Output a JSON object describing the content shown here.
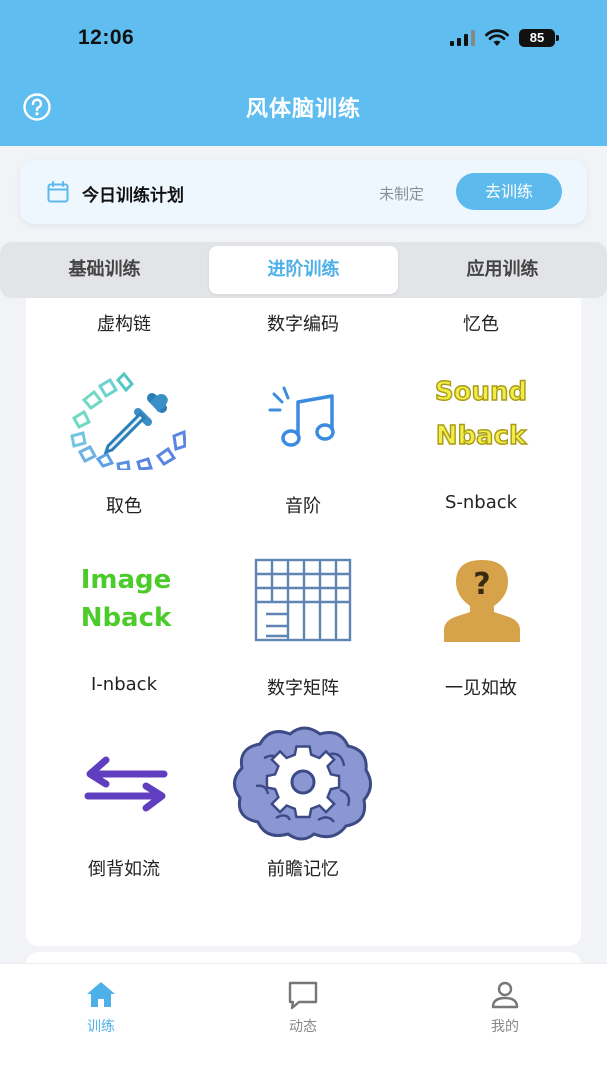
{
  "status_bar": {
    "time": "12:06",
    "battery": "85"
  },
  "header": {
    "title": "风体脑训练",
    "help_icon": "question-circle-icon"
  },
  "plan": {
    "title": "今日训练计划",
    "status": "未制定",
    "button": "去训练",
    "icon": "calendar-icon"
  },
  "tabs": [
    {
      "label": "基础训练",
      "active": false
    },
    {
      "label": "进阶训练",
      "active": true
    },
    {
      "label": "应用训练",
      "active": false
    }
  ],
  "grid": {
    "partial_row": [
      "虚构链",
      "数字编码",
      "忆色"
    ],
    "items": [
      {
        "label": "取色",
        "icon": "color-picker-icon"
      },
      {
        "label": "音阶",
        "icon": "music-note-icon"
      },
      {
        "label": "S-nback",
        "icon": "sound-nback-logo",
        "logo_text": [
          "Sound",
          "Nback"
        ]
      },
      {
        "label": "I-nback",
        "icon": "image-nback-logo",
        "logo_text": [
          "Image",
          "Nback"
        ]
      },
      {
        "label": "数字矩阵",
        "icon": "grid-matrix-icon"
      },
      {
        "label": "一见如故",
        "icon": "person-question-icon"
      },
      {
        "label": "倒背如流",
        "icon": "swap-arrows-icon"
      },
      {
        "label": "前瞻记忆",
        "icon": "brain-gear-icon"
      }
    ]
  },
  "bottom_nav": [
    {
      "label": "训练",
      "icon": "home-icon",
      "active": true
    },
    {
      "label": "动态",
      "icon": "chat-bubble-icon",
      "active": false
    },
    {
      "label": "我的",
      "icon": "person-icon",
      "active": false
    }
  ],
  "colors": {
    "primary": "#5fbdf0",
    "accent_text": "#4eb0e8",
    "background": "#f2f3f6"
  }
}
